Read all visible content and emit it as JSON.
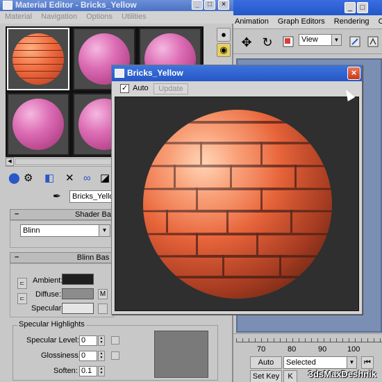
{
  "material_editor": {
    "title": "Material Editor - Bricks_Yellow",
    "menu": [
      "Material",
      "Navigation",
      "Options",
      "Utilities"
    ],
    "material_name": "Bricks_Yello",
    "shader_rollout_title": "Shader Ba",
    "shader_type": "Blinn",
    "blinn_rollout_title": "Blinn Bas",
    "labels": {
      "ambient": "Ambient:",
      "diffuse": "Diffuse:",
      "specular": "Specular:",
      "m": "M",
      "specular_highlights": "Specular Highlights",
      "specular_level": "Specular Level:",
      "glossiness": "Glossiness:",
      "soften": "Soften:"
    },
    "values": {
      "specular_level": "0",
      "glossiness": "0",
      "soften": "0.1"
    },
    "colors": {
      "ambient": "#1e1e1e",
      "diffuse": "#8c8c8c",
      "specular": "#e6e6e6"
    }
  },
  "max_main": {
    "menu": [
      "Animation",
      "Graph Editors",
      "Rendering",
      "Custo"
    ],
    "view_select": "View",
    "timeline_ticks": [
      "70",
      "80",
      "90",
      "100"
    ],
    "auto_key_label": "Auto Key",
    "set_key_label": "Set Key",
    "key_filter_select": "Selected",
    "key_filter_label": "K"
  },
  "magnify_window": {
    "title": "Bricks_Yellow",
    "auto_label": "Auto",
    "auto_checked": true,
    "update_label": "Update"
  },
  "watermark": "3dsMaxDeshnik",
  "icons": {
    "title_minimize": "_",
    "title_maximize": "□",
    "title_close": "×",
    "check": "✓",
    "dropdown": "▼"
  }
}
